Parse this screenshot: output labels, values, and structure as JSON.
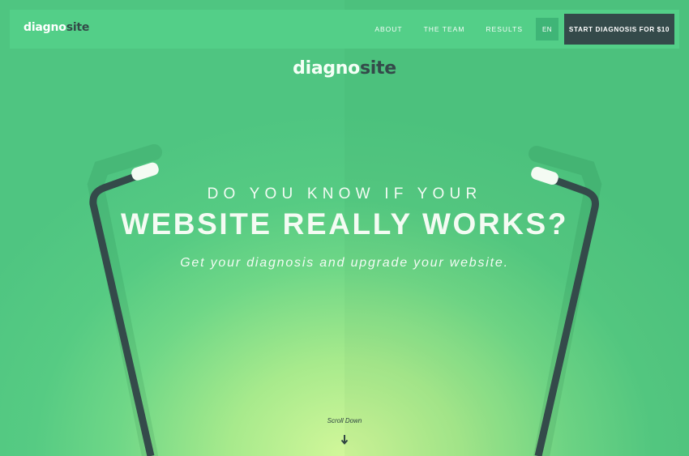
{
  "nav": {
    "logo": {
      "part_a": "diagno",
      "part_b": "site"
    },
    "links": [
      {
        "label": "ABOUT"
      },
      {
        "label": "THE TEAM"
      },
      {
        "label": "RESULTS"
      }
    ],
    "language": "EN",
    "cta": "START DIAGNOSIS FOR $10"
  },
  "hero": {
    "logo": {
      "part_a": "diagno",
      "part_b": "site"
    },
    "headline_small": "DO YOU KNOW IF YOUR",
    "headline_big": "WEBSITE REALLY WORKS?",
    "subline": "Get your diagnosis and upgrade your website.",
    "scroll_label": "Scroll Down"
  },
  "icons": {
    "scroll": "arrow-down-icon",
    "illustration": "stethoscope-illustration"
  },
  "colors": {
    "primary_green": "#53cf88",
    "dark_slate": "#344a4a",
    "light_text": "#f4fbf3",
    "glow": "#d2f79a"
  }
}
